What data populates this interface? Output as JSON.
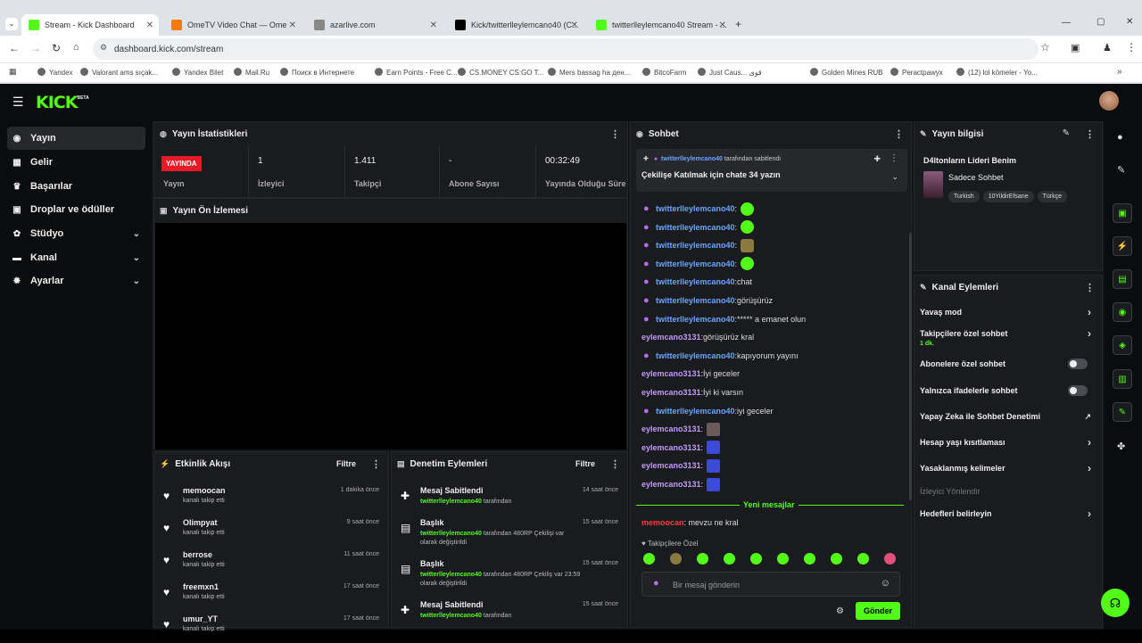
{
  "browser": {
    "tabs": [
      {
        "label": "Stream - Kick Dashboard",
        "active": true,
        "color": "#53fc18"
      },
      {
        "label": "OmeTV Video Chat — Ome",
        "active": false,
        "color": "#f57c00"
      },
      {
        "label": "azarlive.com",
        "active": false,
        "color": "#888888"
      },
      {
        "label": "Kick/twitterlleylemcano40 (C...",
        "active": false,
        "color": "#000000"
      },
      {
        "label": "twitterlleylemcano40 Stream - ...",
        "active": false,
        "color": "#53fc18"
      }
    ],
    "url": "dashboard.kick.com/stream",
    "bookmarks": [
      "Yandex",
      "Valorant ams sıçak...",
      "Yandex Bilet",
      "Mail.Ru",
      "Поиск в Интернете",
      "Earn Points - Free C...",
      "CS.MONEY CS:GO T...",
      "Mers bassag ha ден...",
      "BitcoFarm",
      "Just Caus... قوی",
      "Golden Mines RUB",
      "Peractpawyx",
      "(12) lol kömeler - Yo..."
    ]
  },
  "app": {
    "logo": "KICK",
    "logo_badge": "BETA"
  },
  "sidebar": {
    "items": [
      {
        "label": "Yayın",
        "icon": "stream-icon",
        "glyph": "◉",
        "active": true,
        "chevron": false
      },
      {
        "label": "Gelir",
        "icon": "revenue-icon",
        "glyph": "▦",
        "active": false,
        "chevron": false
      },
      {
        "label": "Başarılar",
        "icon": "trophy-icon",
        "glyph": "♛",
        "active": false,
        "chevron": false
      },
      {
        "label": "Droplar ve ödüller",
        "icon": "gift-icon",
        "glyph": "▣",
        "active": false,
        "chevron": false
      },
      {
        "label": "Stüdyo",
        "icon": "studio-icon",
        "glyph": "✿",
        "active": false,
        "chevron": true
      },
      {
        "label": "Kanal",
        "icon": "channel-icon",
        "glyph": "▬",
        "active": false,
        "chevron": true
      },
      {
        "label": "Ayarlar",
        "icon": "settings-icon",
        "glyph": "✹",
        "active": false,
        "chevron": true
      }
    ]
  },
  "stats": {
    "title": "Yayın İstatistikleri",
    "live_badge": "YAYINDA",
    "live_label": "Yayın",
    "items": [
      {
        "value": "1",
        "label": "İzleyici"
      },
      {
        "value": "1.411",
        "label": "Takipçi"
      },
      {
        "value": "-",
        "label": "Abone Sayısı"
      },
      {
        "value": "00:32:49",
        "label": "Yayında Olduğu Süre"
      }
    ]
  },
  "preview": {
    "title": "Yayın Ön İzlemesi"
  },
  "activity": {
    "title": "Etkinlik Akışı",
    "filter": "Filtre",
    "rows": [
      {
        "name": "memoocan",
        "sub": "kanalı takip etti",
        "time": "1 dakika önce"
      },
      {
        "name": "Olimpyat",
        "sub": "kanalı takip etti",
        "time": "9 saat önce"
      },
      {
        "name": "berrose",
        "sub": "kanalı takip etti",
        "time": "11 saat önce"
      },
      {
        "name": "freemxn1",
        "sub": "kanalı takip etti",
        "time": "17 saat önce"
      },
      {
        "name": "umur_YT",
        "sub": "kanalı takip etti",
        "time": "17 saat önce"
      }
    ]
  },
  "moderation": {
    "title": "Denetim Eylemleri",
    "filter": "Filtre",
    "rows": [
      {
        "icon": "pin-icon",
        "glyph": "✚",
        "name": "Mesaj Sabitlendi",
        "user": "twitterlleylemcano40",
        "rest": " tarafından",
        "line2": "",
        "time": "14 saat önce"
      },
      {
        "icon": "title-icon",
        "glyph": "▤",
        "name": "Başlık",
        "user": "twitterlleylemcano40",
        "rest": " tarafından 480RP Çekilişi var",
        "line2": "olarak değiştirildi",
        "time": "15 saat önce"
      },
      {
        "icon": "title-icon",
        "glyph": "▤",
        "name": "Başlık",
        "user": "twitterlleylemcano40",
        "rest": " tarafından 480RP Çekiliş var 23:59",
        "line2": "olarak değiştirildi",
        "time": "15 saat önce"
      },
      {
        "icon": "pin-icon",
        "glyph": "✚",
        "name": "Mesaj Sabitlendi",
        "user": "twitterlleylemcano40",
        "rest": " tarafından",
        "line2": "",
        "time": "15 saat önce"
      }
    ]
  },
  "chat": {
    "title": "Sohbet",
    "pinned_user": "twitterlleylemcano40",
    "pinned_by": " tarafından sabitlendi",
    "pinned_text": "Çekilişe Katılmak için chate 34 yazın",
    "messages": [
      {
        "user": "twitterlleylemcano40",
        "cls": "u1",
        "mic": true,
        "text": ":",
        "emote": "green"
      },
      {
        "user": "twitterlleylemcano40",
        "cls": "u1",
        "mic": true,
        "text": ":",
        "emote": "green"
      },
      {
        "user": "twitterlleylemcano40",
        "cls": "u1",
        "mic": true,
        "text": ":",
        "emote": "sq"
      },
      {
        "user": "twitterlleylemcano40",
        "cls": "u1",
        "mic": true,
        "text": ":",
        "emote": "green"
      },
      {
        "user": "twitterlleylemcano40",
        "cls": "u1",
        "mic": true,
        "text": ":chat",
        "emote": ""
      },
      {
        "user": "twitterlleylemcano40",
        "cls": "u1",
        "mic": true,
        "text": ":görüşürüz",
        "emote": ""
      },
      {
        "user": "twitterlleylemcano40",
        "cls": "u1",
        "mic": true,
        "text": ":***** a emanet olun",
        "emote": ""
      },
      {
        "user": "eylemcano3131",
        "cls": "u2",
        "mic": false,
        "text": ":görüşürüz kral",
        "emote": ""
      },
      {
        "user": "twitterlleylemcano40",
        "cls": "u1",
        "mic": true,
        "text": ":kapıyorum yayını",
        "emote": ""
      },
      {
        "user": "eylemcano3131",
        "cls": "u2",
        "mic": false,
        "text": ":İyi geceler",
        "emote": ""
      },
      {
        "user": "eylemcano3131",
        "cls": "u2",
        "mic": false,
        "text": ":İyi ki varsın",
        "emote": ""
      },
      {
        "user": "twitterlleylemcano40",
        "cls": "u1",
        "mic": true,
        "text": ":iyi geceler",
        "emote": ""
      },
      {
        "user": "eylemcano3131",
        "cls": "u2",
        "mic": false,
        "text": ":",
        "emote": "img"
      },
      {
        "user": "eylemcano3131",
        "cls": "u2",
        "mic": false,
        "text": ":",
        "emote": "blue"
      },
      {
        "user": "eylemcano3131",
        "cls": "u2",
        "mic": false,
        "text": ":",
        "emote": "blue"
      },
      {
        "user": "eylemcano3131",
        "cls": "u2",
        "mic": false,
        "text": ":",
        "emote": "blue"
      }
    ],
    "new_messages": "Yeni mesajlar",
    "last_message": {
      "user": "memoocan",
      "text": ": mevzu ne kral"
    },
    "followers_only": "♥ Takipçilere Özel",
    "input_placeholder": "Bir mesaj gönderin",
    "send": "Gönder",
    "accent": "#53fc18"
  },
  "stream_info": {
    "title": "Yayın bilgisi",
    "stream_title": "D4ltonların Lideri Benim",
    "category": "Sadece Sohbet",
    "tags": [
      "Turkish",
      "10YildirEfsane",
      "Türkçe"
    ]
  },
  "channel_actions": {
    "title": "Kanal Eylemleri",
    "rows": [
      {
        "label": "Yavaş mod",
        "sub": "",
        "control": "arrow"
      },
      {
        "label": "Takipçilere özel sohbet",
        "sub": "1 dk.",
        "control": "arrow"
      },
      {
        "label": "Abonelere özel sohbet",
        "sub": "",
        "control": "toggle"
      },
      {
        "label": "Yalnızca ifadelerle sohbet",
        "sub": "",
        "control": "toggle"
      },
      {
        "label": "Yapay Zeka ile Sohbet Denetimi",
        "sub": "",
        "control": "external"
      },
      {
        "label": "Hesap yaşı kısıtlaması",
        "sub": "",
        "control": "arrow"
      },
      {
        "label": "Yasaklanmış kelimeler",
        "sub": "",
        "control": "arrow"
      },
      {
        "label": "İzleyici Yönlendir",
        "sub": "",
        "control": "disabled"
      },
      {
        "label": "Hedefleri belirleyin",
        "sub": "",
        "control": "arrow"
      }
    ]
  }
}
